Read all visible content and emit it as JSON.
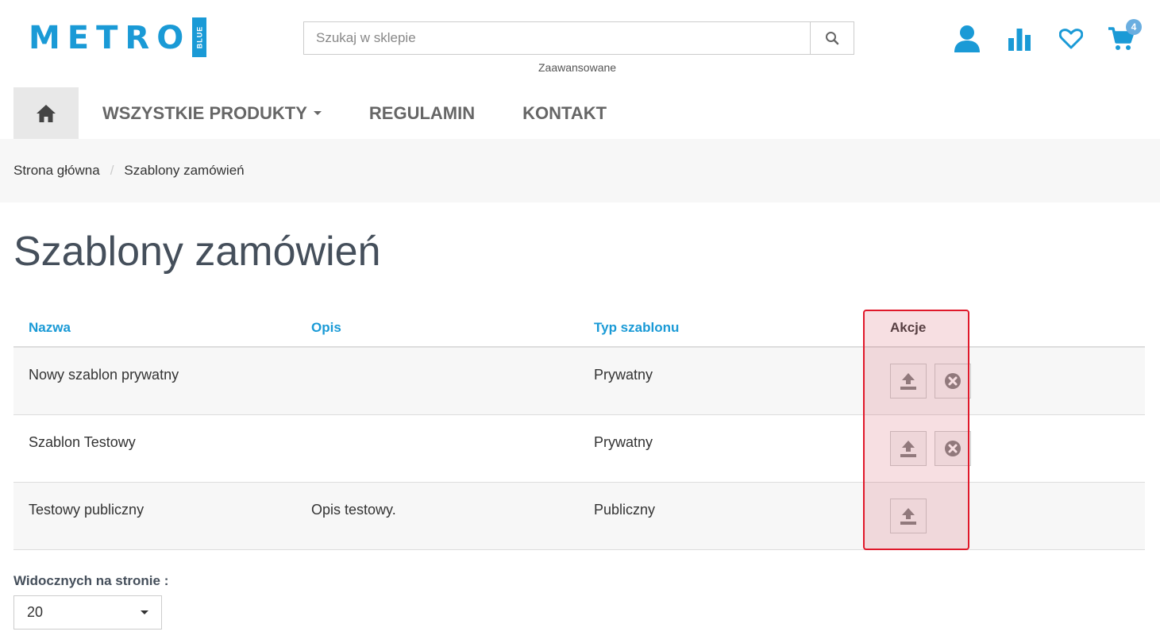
{
  "logo": {
    "text": "METRO",
    "badge": "BLUE"
  },
  "search": {
    "placeholder": "Szukaj w sklepie",
    "advanced_label": "Zaawansowane"
  },
  "cart": {
    "count": "4"
  },
  "nav": {
    "items": [
      {
        "label": "WSZYSTKIE PRODUKTY"
      },
      {
        "label": "REGULAMIN"
      },
      {
        "label": "KONTAKT"
      }
    ]
  },
  "breadcrumb": {
    "home": "Strona główna",
    "separator": "/",
    "current": "Szablony zamówień"
  },
  "page": {
    "title": "Szablony zamówień"
  },
  "table": {
    "headers": {
      "name": "Nazwa",
      "description": "Opis",
      "type": "Typ szablonu",
      "actions": "Akcje"
    },
    "rows": [
      {
        "name": "Nowy szablon prywatny",
        "description": "",
        "type": "Prywatny",
        "actions": [
          "upload",
          "delete"
        ]
      },
      {
        "name": "Szablon Testowy",
        "description": "",
        "type": "Prywatny",
        "actions": [
          "upload",
          "delete"
        ]
      },
      {
        "name": "Testowy publiczny",
        "description": "Opis testowy.",
        "type": "Publiczny",
        "actions": [
          "upload"
        ]
      }
    ]
  },
  "pagination": {
    "per_page_label": "Widocznych na stronie :",
    "per_page_value": "20"
  },
  "colors": {
    "brand": "#1a9ad6",
    "highlight": "#e0182a"
  }
}
